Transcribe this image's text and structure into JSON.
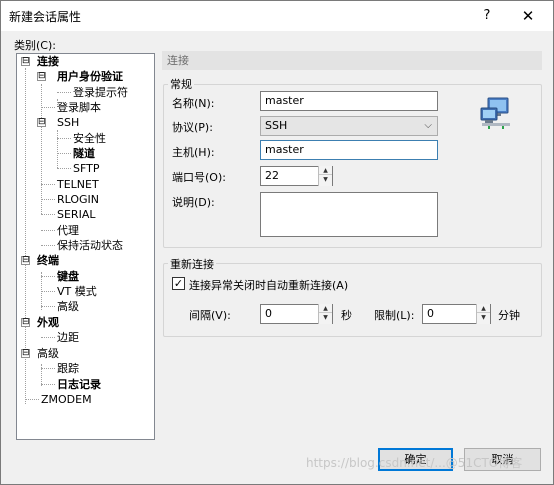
{
  "window": {
    "title": "新建会话属性",
    "help_glyph": "?",
    "close_glyph": "✕"
  },
  "category_label": "类别(C):",
  "tree": {
    "items": [
      {
        "label": "连接",
        "bold": true,
        "expander": "⊟"
      },
      {
        "label": "用户身份验证",
        "bold": true,
        "expander": "⊟"
      },
      {
        "label": "登录提示符",
        "bold": false
      },
      {
        "label": "登录脚本",
        "bold": false
      },
      {
        "label": "SSH",
        "bold": false,
        "expander": "⊟"
      },
      {
        "label": "安全性",
        "bold": false
      },
      {
        "label": "隧道",
        "bold": true
      },
      {
        "label": "SFTP",
        "bold": false
      },
      {
        "label": "TELNET",
        "bold": false
      },
      {
        "label": "RLOGIN",
        "bold": false
      },
      {
        "label": "SERIAL",
        "bold": false
      },
      {
        "label": "代理",
        "bold": false
      },
      {
        "label": "保持活动状态",
        "bold": false
      },
      {
        "label": "终端",
        "bold": true,
        "expander": "⊟"
      },
      {
        "label": "键盘",
        "bold": true
      },
      {
        "label": "VT 模式",
        "bold": false
      },
      {
        "label": "高级",
        "bold": false
      },
      {
        "label": "外观",
        "bold": true,
        "expander": "⊟"
      },
      {
        "label": "边距",
        "bold": false
      },
      {
        "label": "高级",
        "bold": false,
        "expander": "⊟"
      },
      {
        "label": "跟踪",
        "bold": false
      },
      {
        "label": "日志记录",
        "bold": true
      },
      {
        "label": "ZMODEM",
        "bold": false
      }
    ]
  },
  "section_header": "连接",
  "general": {
    "title": "常规",
    "name_label": "名称(N):",
    "name_value": "master",
    "protocol_label": "协议(P):",
    "protocol_value": "SSH",
    "host_label": "主机(H):",
    "host_value": "master",
    "port_label": "端口号(O):",
    "port_value": "22",
    "desc_label": "说明(D):",
    "desc_value": ""
  },
  "reconnect": {
    "title": "重新连接",
    "auto_label": "连接异常关闭时自动重新连接(A)",
    "auto_checked": true,
    "check_glyph": "✓",
    "interval_label": "间隔(V):",
    "interval_value": "0",
    "interval_unit": "秒",
    "limit_label": "限制(L):",
    "limit_value": "0",
    "limit_unit": "分钟"
  },
  "buttons": {
    "ok": "确定",
    "cancel": "取消"
  },
  "spin_up": "▲",
  "spin_down": "▼",
  "dropdown_arrow": "⌵",
  "watermark": "https://blog.csdn.net/...@51CTO博客",
  "icons": {
    "session_icon": "network-computer-icon"
  },
  "colors": {
    "selection": "#3399ff",
    "default_button_border": "#0078d7",
    "dialog_bg": "#f0f0f0"
  }
}
